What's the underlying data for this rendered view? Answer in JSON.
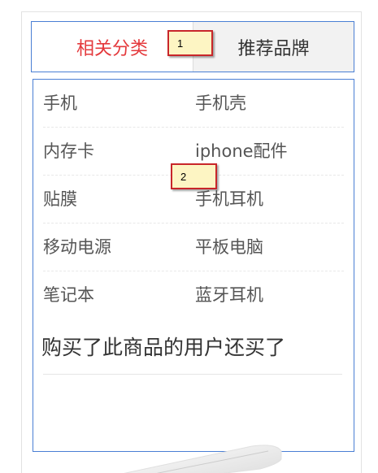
{
  "tabs": {
    "related_categories": "相关分类",
    "recommended_brands": "推荐品牌"
  },
  "categories": [
    {
      "left": "手机",
      "right": "手机壳"
    },
    {
      "left": "内存卡",
      "right": "iphone配件"
    },
    {
      "left": "贴膜",
      "right": "手机耳机"
    },
    {
      "left": "移动电源",
      "right": "平板电脑"
    },
    {
      "left": "笔记本",
      "right": "蓝牙耳机"
    }
  ],
  "also_bought": {
    "title": "购买了此商品的用户还买了"
  },
  "markers": {
    "one": "1",
    "two": "2"
  },
  "colors": {
    "active_tab": "#e4393c",
    "highlight_border": "#4a7fd4",
    "marker_fill": "#fdf5c3",
    "marker_border": "#c8262a"
  }
}
